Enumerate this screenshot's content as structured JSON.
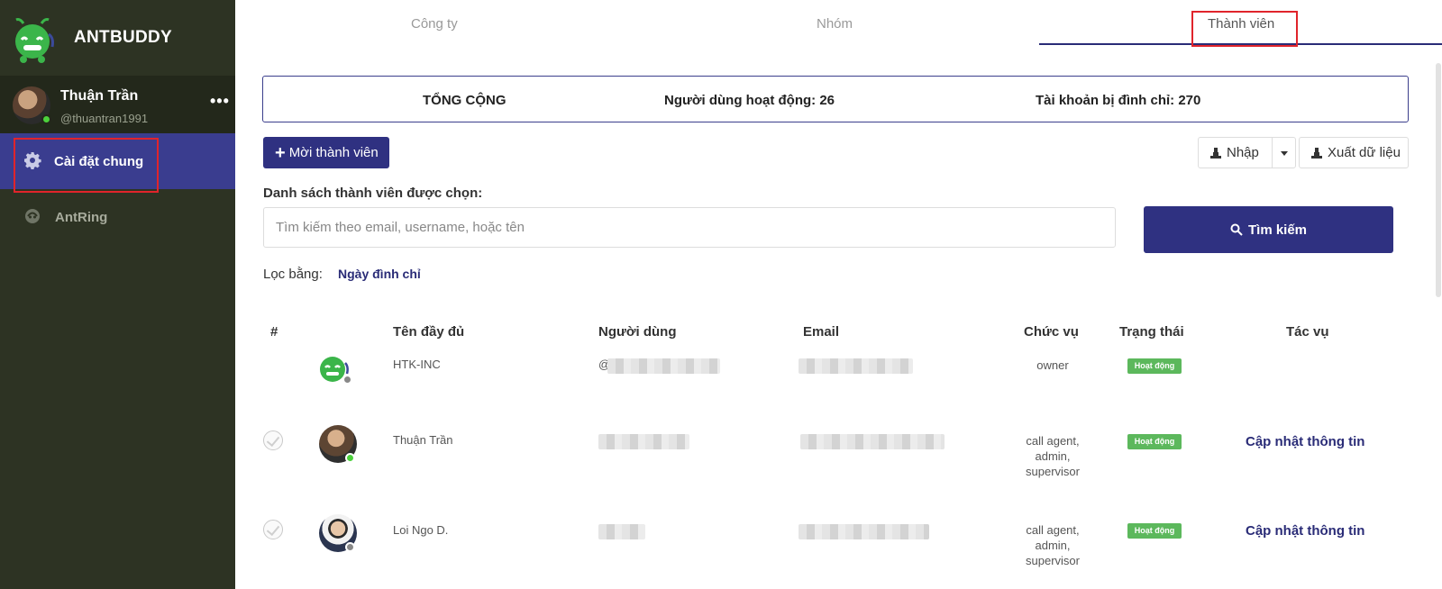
{
  "brand": {
    "name": "ANTBUDDY"
  },
  "profile": {
    "name": "Thuận Trần",
    "handle": "@thuantran1991",
    "more": "•••"
  },
  "sidebar": {
    "items": [
      {
        "label": "Cài đặt chung"
      },
      {
        "label": "AntRing"
      }
    ]
  },
  "tabs": [
    {
      "label": "Công ty"
    },
    {
      "label": "Nhóm"
    },
    {
      "label": "Thành viên"
    }
  ],
  "summary": {
    "total": "TỔNG CỘNG",
    "active": "Người dùng hoạt động: 26",
    "suspended": "Tài khoản bị đình chỉ: 270"
  },
  "toolbar": {
    "invite": "Mời thành viên",
    "import": "Nhập",
    "export": "Xuất dữ liệu"
  },
  "selection": {
    "label": "Danh sách thành viên được chọn:"
  },
  "search": {
    "placeholder": "Tìm kiếm theo email, username, hoặc tên",
    "button": "Tìm kiếm"
  },
  "filter": {
    "label": "Lọc bằng:",
    "option": "Ngày đình chỉ"
  },
  "table": {
    "headers": [
      "#",
      "Tên đầy đủ",
      "Người dùng",
      "Email",
      "Chức vụ",
      "Trạng thái",
      "Tác vụ"
    ],
    "rows": [
      {
        "name": "HTK-INC",
        "username": "@",
        "role": "owner",
        "status": "Hoạt động",
        "action": ""
      },
      {
        "name": "Thuận Trần",
        "username": "",
        "role": "call agent,\nadmin,\nsupervisor",
        "status": "Hoạt động",
        "action": "Cập nhật thông tin"
      },
      {
        "name": "Loi Ngo D.",
        "username": "",
        "role": "call agent,\nadmin,\nsupervisor",
        "status": "Hoạt động",
        "action": "Cập nhật thông tin"
      }
    ]
  },
  "colors": {
    "sidebar": "#2d3323",
    "accent": "#2f3181",
    "badge": "#5cb85c",
    "highlight": "#e0242b"
  }
}
